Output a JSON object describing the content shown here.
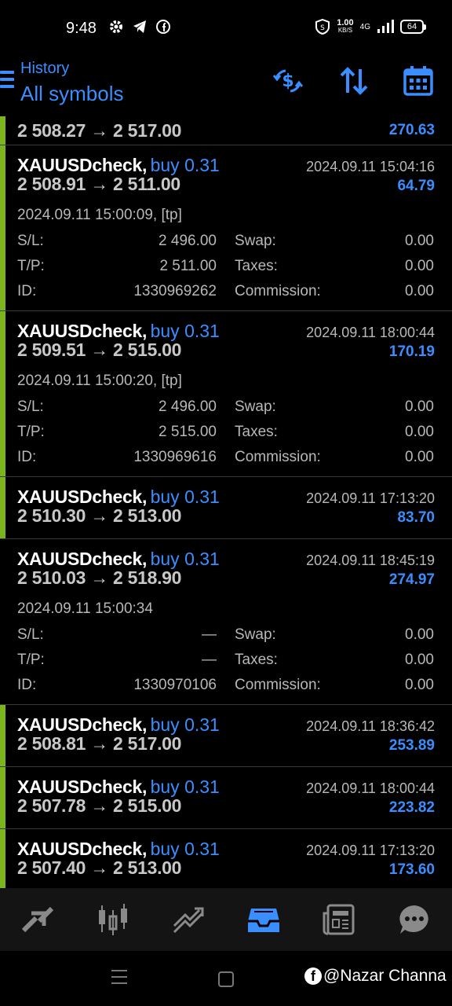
{
  "status_bar": {
    "time": "9:48",
    "net_speed": "1.00",
    "net_unit": "KB/S",
    "network": "4G",
    "battery": "64"
  },
  "header": {
    "subtitle": "History",
    "title": "All symbols"
  },
  "labels": {
    "sl": "S/L:",
    "tp": "T/P:",
    "id": "ID:",
    "swap": "Swap:",
    "taxes": "Taxes:",
    "commission": "Commission:"
  },
  "trades": [
    {
      "prices": "2 508.27 → 2 517.00",
      "profit": "270.63"
    },
    {
      "symbol": "XAUUSDcheck,",
      "direction": "buy 0.31",
      "date": "2024.09.11 15:04:16",
      "prices": "2 508.91 → 2 511.00",
      "profit": "64.79",
      "open_line": "2024.09.11 15:00:09, [tp]",
      "sl": "2 496.00",
      "tp": "2 511.00",
      "id": "1330969262",
      "swap": "0.00",
      "taxes": "0.00",
      "commission": "0.00"
    },
    {
      "symbol": "XAUUSDcheck,",
      "direction": "buy 0.31",
      "date": "2024.09.11 18:00:44",
      "prices": "2 509.51 → 2 515.00",
      "profit": "170.19",
      "open_line": "2024.09.11 15:00:20, [tp]",
      "sl": "2 496.00",
      "tp": "2 515.00",
      "id": "1330969616",
      "swap": "0.00",
      "taxes": "0.00",
      "commission": "0.00"
    },
    {
      "symbol": "XAUUSDcheck,",
      "direction": "buy 0.31",
      "date": "2024.09.11 17:13:20",
      "prices": "2 510.30 → 2 513.00",
      "profit": "83.70"
    },
    {
      "symbol": "XAUUSDcheck,",
      "direction": "buy 0.31",
      "date": "2024.09.11 18:45:19",
      "prices": "2 510.03 → 2 518.90",
      "profit": "274.97",
      "open_line": "2024.09.11 15:00:34",
      "sl": "—",
      "tp": "—",
      "id": "1330970106",
      "swap": "0.00",
      "taxes": "0.00",
      "commission": "0.00"
    },
    {
      "symbol": "XAUUSDcheck,",
      "direction": "buy 0.31",
      "date": "2024.09.11 18:36:42",
      "prices": "2 508.81 → 2 517.00",
      "profit": "253.89"
    },
    {
      "symbol": "XAUUSDcheck,",
      "direction": "buy 0.31",
      "date": "2024.09.11 18:00:44",
      "prices": "2 507.78 → 2 515.00",
      "profit": "223.82"
    },
    {
      "symbol": "XAUUSDcheck,",
      "direction": "buy 0.31",
      "date": "2024.09.11 17:13:20",
      "prices": "2 507.40 → 2 513.00",
      "profit": "173.60"
    }
  ],
  "bottom_nav": [
    {
      "icon": "quotes-icon"
    },
    {
      "icon": "chart-icon"
    },
    {
      "icon": "trade-icon"
    },
    {
      "icon": "history-icon",
      "active": true
    },
    {
      "icon": "news-icon"
    },
    {
      "icon": "messages-icon"
    }
  ],
  "watermark": "@Nazar Channa",
  "colors": {
    "accent": "#3a8eff",
    "bar": "#7ab51d",
    "background": "#000000"
  }
}
